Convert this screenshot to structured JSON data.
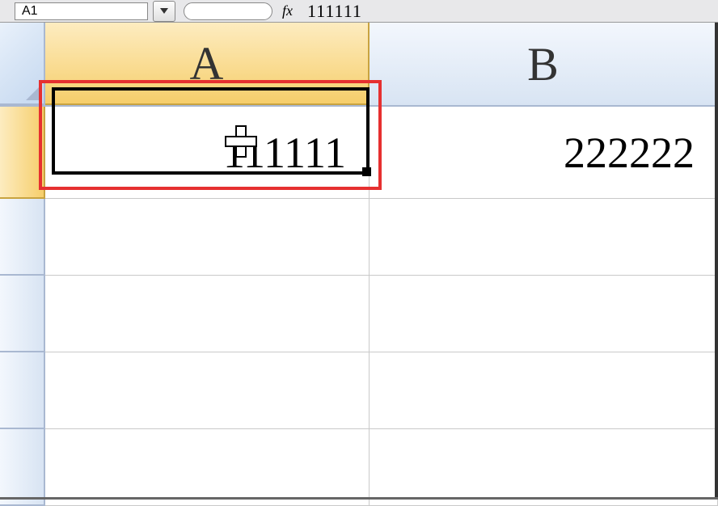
{
  "formula_bar": {
    "name_box": "A1",
    "fx_label": "fx",
    "formula_value": "111111"
  },
  "columns": {
    "a": "A",
    "b": "B"
  },
  "cells": {
    "a1": "111111",
    "b1": "222222"
  },
  "selected_cell": "A1",
  "colors": {
    "highlight_box": "#e63030",
    "selected_header": "#f6ce6b",
    "normal_header": "#d8e4f3"
  }
}
